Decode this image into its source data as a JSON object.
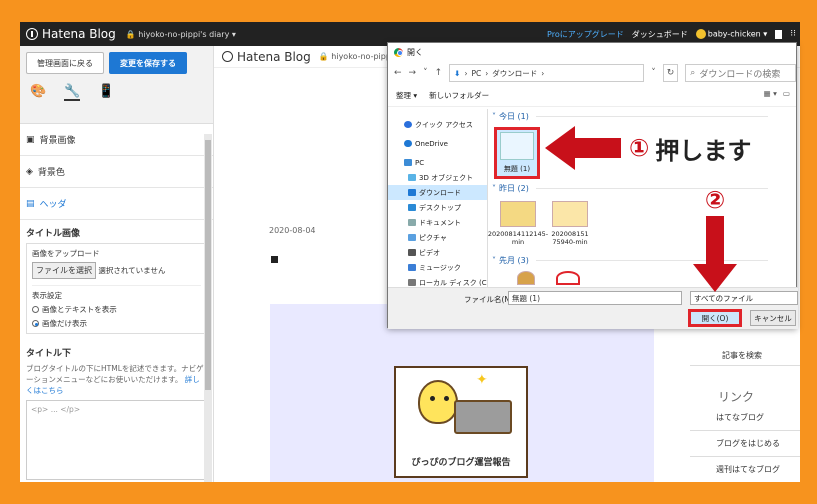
{
  "topbar": {
    "logo": "Hatena Blog",
    "blog": "hiyoko-no-pippi's diary ▾",
    "pro": "Proにアップグレード",
    "dashboard": "ダッシュボード",
    "user": "baby-chicken ▾"
  },
  "sidebar": {
    "back": "管理画面に戻る",
    "save": "変更を保存する",
    "bg_image": "背景画像",
    "bg_color": "背景色",
    "header": "ヘッダ",
    "title_image": "タイトル画像",
    "upload": "画像をアップロード",
    "choose_file": "ファイルを選択",
    "no_file": "選択されていません",
    "display": "表示設定",
    "opt1": "画像とテキストを表示",
    "opt2": "画像だけ表示",
    "title_below": "タイトル下",
    "desc": "ブログタイトルの下にHTMLを記述できます。ナビゲーションメニューなどにお使いいただけます。",
    "desc_link": "詳しくはこちら",
    "html_ph": "<p> ... </p>"
  },
  "preview": {
    "logo": "Hatena Blog",
    "domain": "hiyoko-no-pippi's d",
    "date": "2020-08-04",
    "hero_text": "ぴっぴのブログ運営報告",
    "search": "記事を検索",
    "link_title": "リンク",
    "links": [
      "はてなブログ",
      "ブログをはじめる",
      "週刊はてなブログ"
    ]
  },
  "dialog": {
    "title": "開く",
    "path1": "PC",
    "path2": "ダウンロード",
    "search_ph": "ダウンロードの検索",
    "organize": "整理 ▾",
    "new_folder": "新しいフォルダー",
    "nav": [
      {
        "icon": "star-icon",
        "label": "クイック アクセス",
        "color": "#2a6fdc"
      },
      {
        "icon": "cloud-icon",
        "label": "OneDrive",
        "color": "#1e78d4"
      },
      {
        "icon": "pc-icon",
        "label": "PC",
        "color": "#3c8cd6"
      },
      {
        "icon": "cube-icon",
        "label": "3D オブジェクト",
        "color": "#59b3e6"
      },
      {
        "icon": "download-icon",
        "label": "ダウンロード",
        "color": "#1e78d4"
      },
      {
        "icon": "desktop-icon",
        "label": "デスクトップ",
        "color": "#2a8ad6"
      },
      {
        "icon": "doc-icon",
        "label": "ドキュメント",
        "color": "#8aa"
      },
      {
        "icon": "picture-icon",
        "label": "ピクチャ",
        "color": "#5aa0e0"
      },
      {
        "icon": "video-icon",
        "label": "ビデオ",
        "color": "#555"
      },
      {
        "icon": "music-icon",
        "label": "ミュージック",
        "color": "#3b7ed6"
      },
      {
        "icon": "disk-icon",
        "label": "ローカル ディスク (C",
        "color": "#777"
      }
    ],
    "group_today": "今日 (1)",
    "group_yesterday": "昨日 (2)",
    "group_lastmonth": "先月 (3)",
    "file_today": "無題 (1)",
    "file_y1": "20200814112145-min",
    "file_y2": "202008151 75940-min",
    "fname_label": "ファイル名(N):",
    "fname_value": "無題 (1)",
    "filter": "すべてのファイル",
    "open": "開く(O)",
    "cancel": "キャンセル"
  },
  "annotations": {
    "num1": "①",
    "text1": "押します",
    "num2": "②"
  }
}
